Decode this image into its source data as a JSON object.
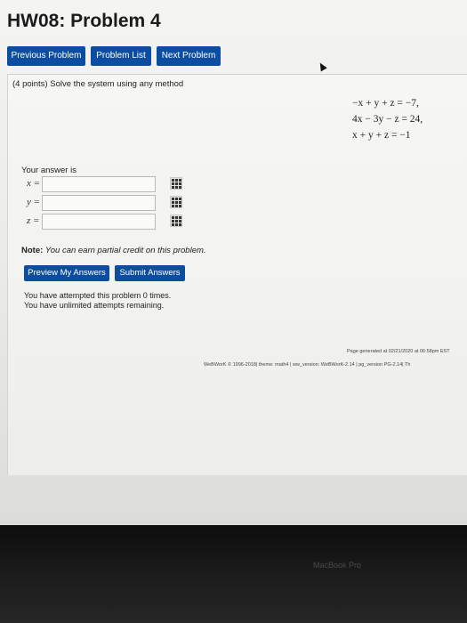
{
  "page": {
    "title": "HW08: Problem 4"
  },
  "nav": {
    "previous": "Previous Problem",
    "list": "Problem List",
    "next": "Next Problem"
  },
  "problem": {
    "points": "(4 points) Solve the system using any method",
    "equations": [
      "−x + y + z = −7,",
      "4x − 3y − z = 24,",
      "x + y + z = −1"
    ]
  },
  "answer": {
    "label": "Your answer is",
    "vars": [
      "x =",
      "y =",
      "z ="
    ]
  },
  "note": {
    "bold": "Note:",
    "text": "You can earn partial credit on this problem."
  },
  "actions": {
    "preview": "Preview My Answers",
    "submit": "Submit Answers"
  },
  "status": {
    "attempts": "You have attempted this problem 0 times.",
    "remaining": "You have unlimited attempts remaining."
  },
  "footer": {
    "generated": "Page generated at 02/21/2020 at 06:58pm EST",
    "version": "WeBWorK © 1996-2018| theme: math4 | ww_version: WeBWorK-2.14 | pg_version PG-2.14| Th"
  },
  "device": {
    "label": "MacBook Pro"
  }
}
